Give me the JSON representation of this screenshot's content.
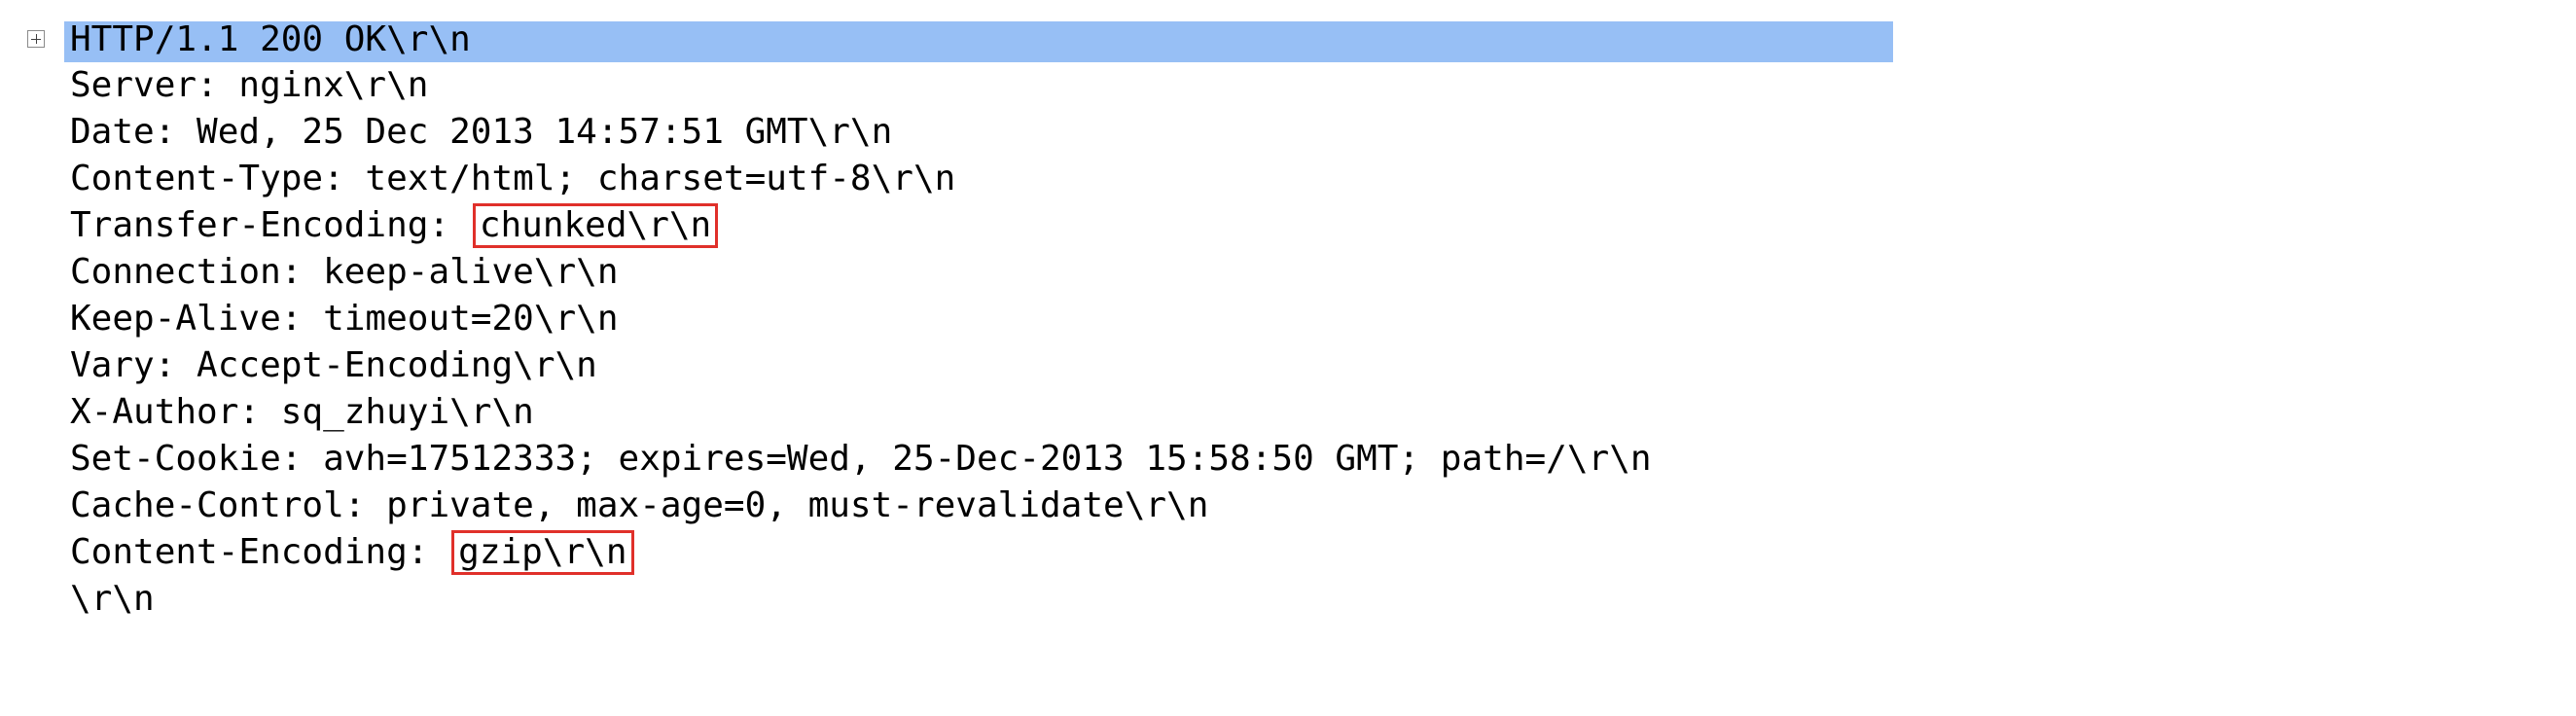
{
  "header_row": {
    "text": "HTTP/1.1 200 OK\\r\\n",
    "selected_color": "#97bff5"
  },
  "headers": [
    {
      "text": "Server: nginx\\r\\n"
    },
    {
      "text": "Date: Wed, 25 Dec 2013 14:57:51 GMT\\r\\n"
    },
    {
      "text": "Content-Type: text/html; charset=utf-8\\r\\n"
    },
    {
      "label": "Transfer-Encoding: ",
      "value": "chunked\\r\\n",
      "highlight_color": "#e0302a"
    },
    {
      "text": "Connection: keep-alive\\r\\n"
    },
    {
      "text": "Keep-Alive: timeout=20\\r\\n"
    },
    {
      "text": "Vary: Accept-Encoding\\r\\n"
    },
    {
      "text": "X-Author: sq_zhuyi\\r\\n"
    },
    {
      "text": "Set-Cookie: avh=17512333; expires=Wed, 25-Dec-2013 15:58:50 GMT; path=/\\r\\n"
    },
    {
      "text": "Cache-Control: private, max-age=0, must-revalidate\\r\\n"
    },
    {
      "label": "Content-Encoding: ",
      "value": "gzip\\r\\n",
      "highlight_color": "#e0302a"
    },
    {
      "text": "\\r\\n"
    }
  ],
  "icons": {
    "expander": "plus-box-icon"
  }
}
